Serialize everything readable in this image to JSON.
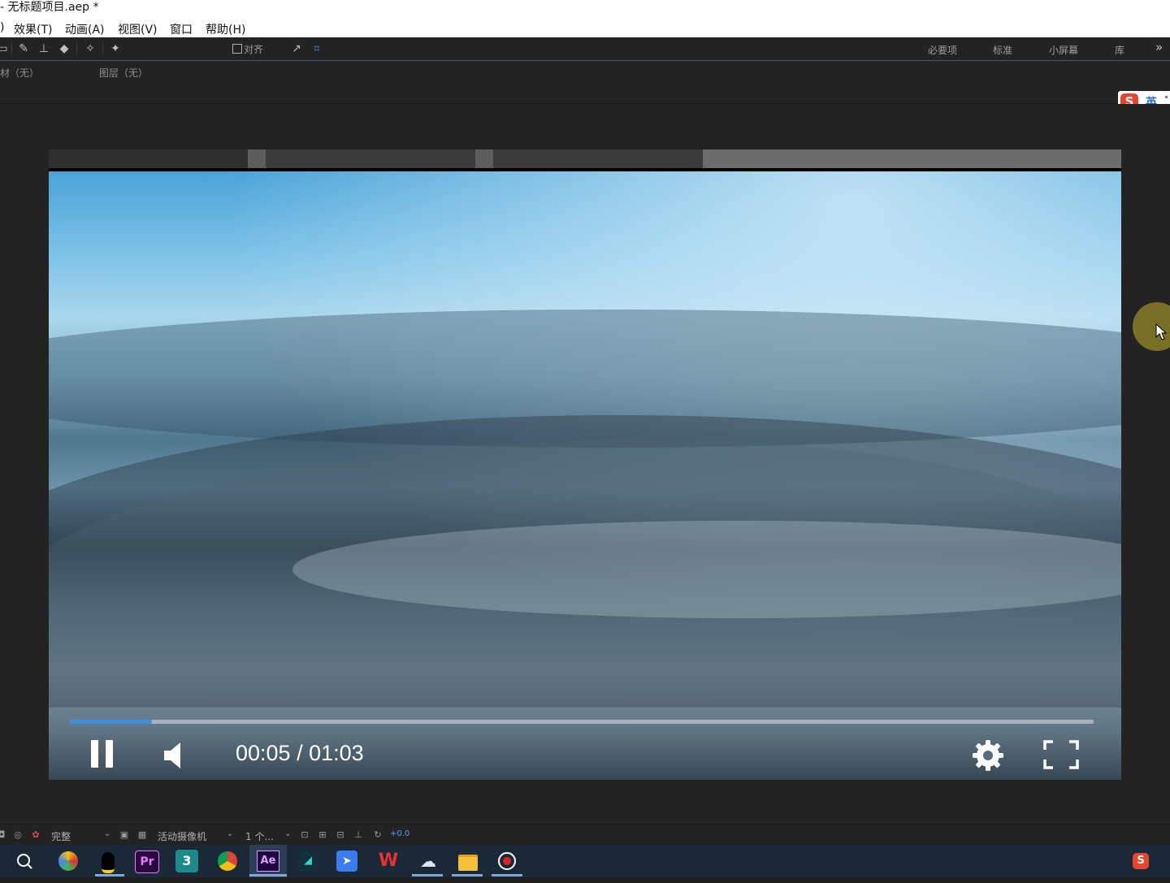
{
  "window": {
    "title": "- 无标题项目.aep *"
  },
  "menu": [
    ")",
    "效果(T)",
    "动画(A)",
    "视图(V)",
    "窗口",
    "帮助(H)"
  ],
  "toolbar": {
    "align_label": "对齐",
    "workspaces": [
      "必要项",
      "标准",
      "小屏幕",
      "库"
    ],
    "more": "»"
  },
  "panels": {
    "footage": "材（无）",
    "layer": "图层（无）"
  },
  "ime": {
    "logo": "S",
    "lang": "英"
  },
  "player": {
    "time": "00:05 / 01:03",
    "progress": 0.08,
    "icons": [
      "pause-icon",
      "volume-icon",
      "settings-icon",
      "fullscreen-icon"
    ]
  },
  "viewer_bar": {
    "resolution": "完整",
    "camera": "活动摄像机",
    "views": "1 个...",
    "exposure": "+0.0",
    "exposure_color": "#4aa3ff"
  },
  "taskbar": {
    "apps": [
      {
        "name": "search",
        "label": ""
      },
      {
        "name": "browser",
        "label": ""
      },
      {
        "name": "qq",
        "label": ""
      },
      {
        "name": "premiere",
        "label": "Pr"
      },
      {
        "name": "3dsmax",
        "label": "3"
      },
      {
        "name": "chrome",
        "label": ""
      },
      {
        "name": "after-effects",
        "label": "Ae"
      },
      {
        "name": "app-dark",
        "label": ""
      },
      {
        "name": "feishu",
        "label": ""
      },
      {
        "name": "wps",
        "label": "W"
      },
      {
        "name": "chat",
        "label": ""
      },
      {
        "name": "file-explorer",
        "label": ""
      },
      {
        "name": "recorder",
        "label": ""
      }
    ],
    "tray_logo": "S"
  }
}
